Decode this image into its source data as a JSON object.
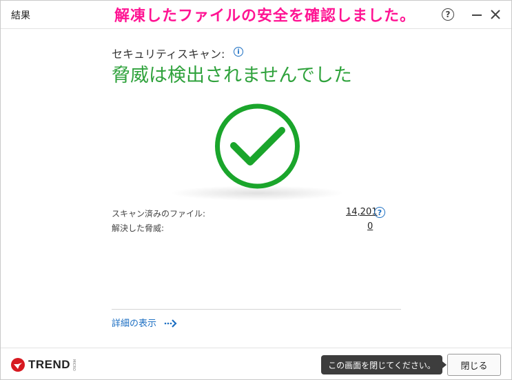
{
  "window": {
    "title": "結果",
    "annotation": "解凍したファイルの安全を確認しました。"
  },
  "result": {
    "scan_label": "セキュリティスキャン:",
    "status": "脅威は検出されませんでした"
  },
  "stats": {
    "scanned_label": "スキャン済みのファイル:",
    "scanned_value": "14,201",
    "resolved_label": "解決した脅威:",
    "resolved_value": "0"
  },
  "details_link": "詳細の表示",
  "footer": {
    "logo_text": "TREND",
    "logo_sub": "MICRO",
    "tooltip": "この画面を閉じてください。",
    "close_button": "閉じる"
  },
  "colors": {
    "success_green": "#2fa23c",
    "check_green": "#1aa52b",
    "link_blue": "#1b6ec2",
    "annotation_pink": "#ff1493",
    "logo_red": "#d71920"
  },
  "icons": {
    "help": "question-circle-icon",
    "minimize": "minimize-icon",
    "close": "close-icon",
    "info": "info-icon",
    "check": "check-circle-icon",
    "arrow": "dotted-arrow-right-icon"
  }
}
